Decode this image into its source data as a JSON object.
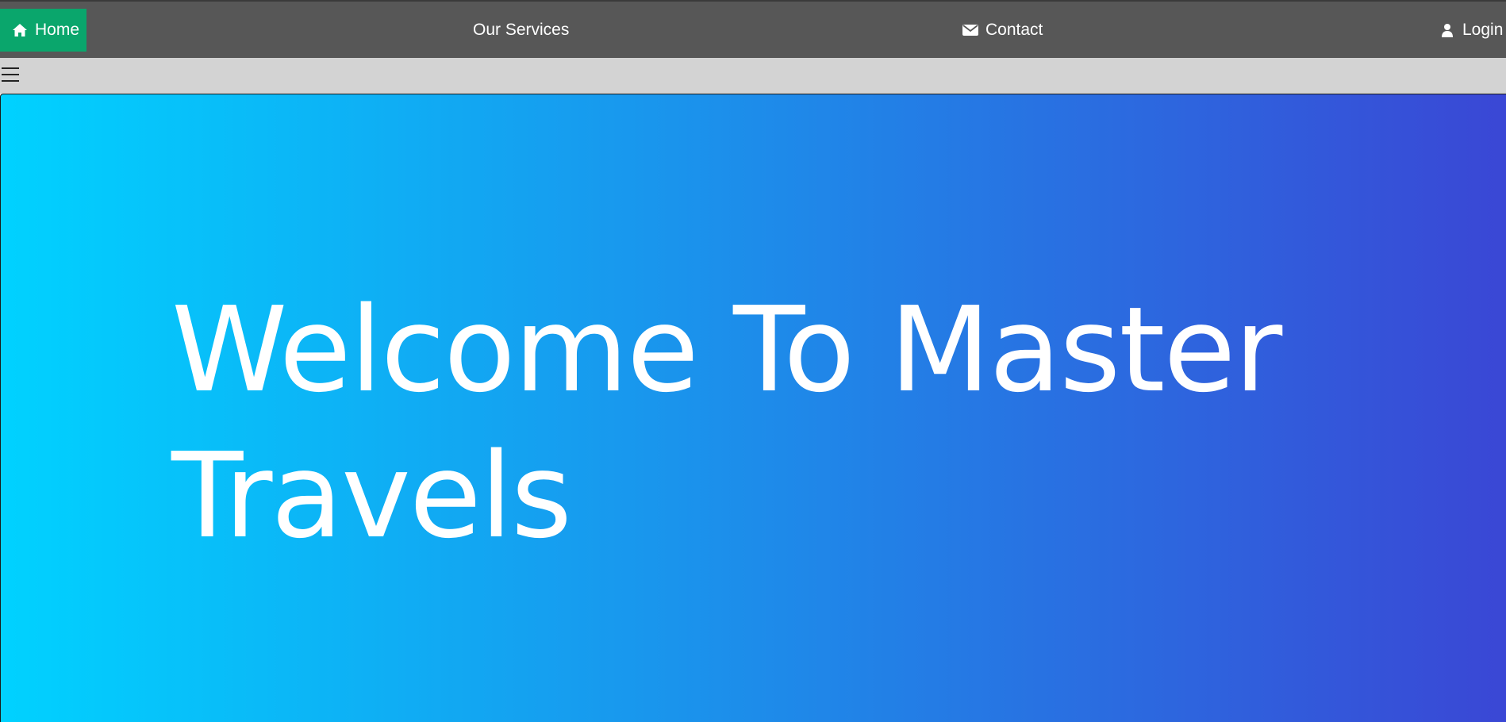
{
  "nav": {
    "home": {
      "label": "Home",
      "icon": "home-icon"
    },
    "services": {
      "label": "Our Services"
    },
    "contact": {
      "label": "Contact",
      "icon": "envelope-icon"
    },
    "login": {
      "label": "Login",
      "icon": "user-icon"
    }
  },
  "menu": {
    "icon": "hamburger-menu-icon"
  },
  "hero": {
    "title": "Welcome To Master Travels",
    "gradient_start": "#00d2ff",
    "gradient_end": "#3a47d5"
  },
  "colors": {
    "nav_background": "#575757",
    "nav_active": "#0aa66c",
    "subbar_background": "#d3d3d3"
  }
}
